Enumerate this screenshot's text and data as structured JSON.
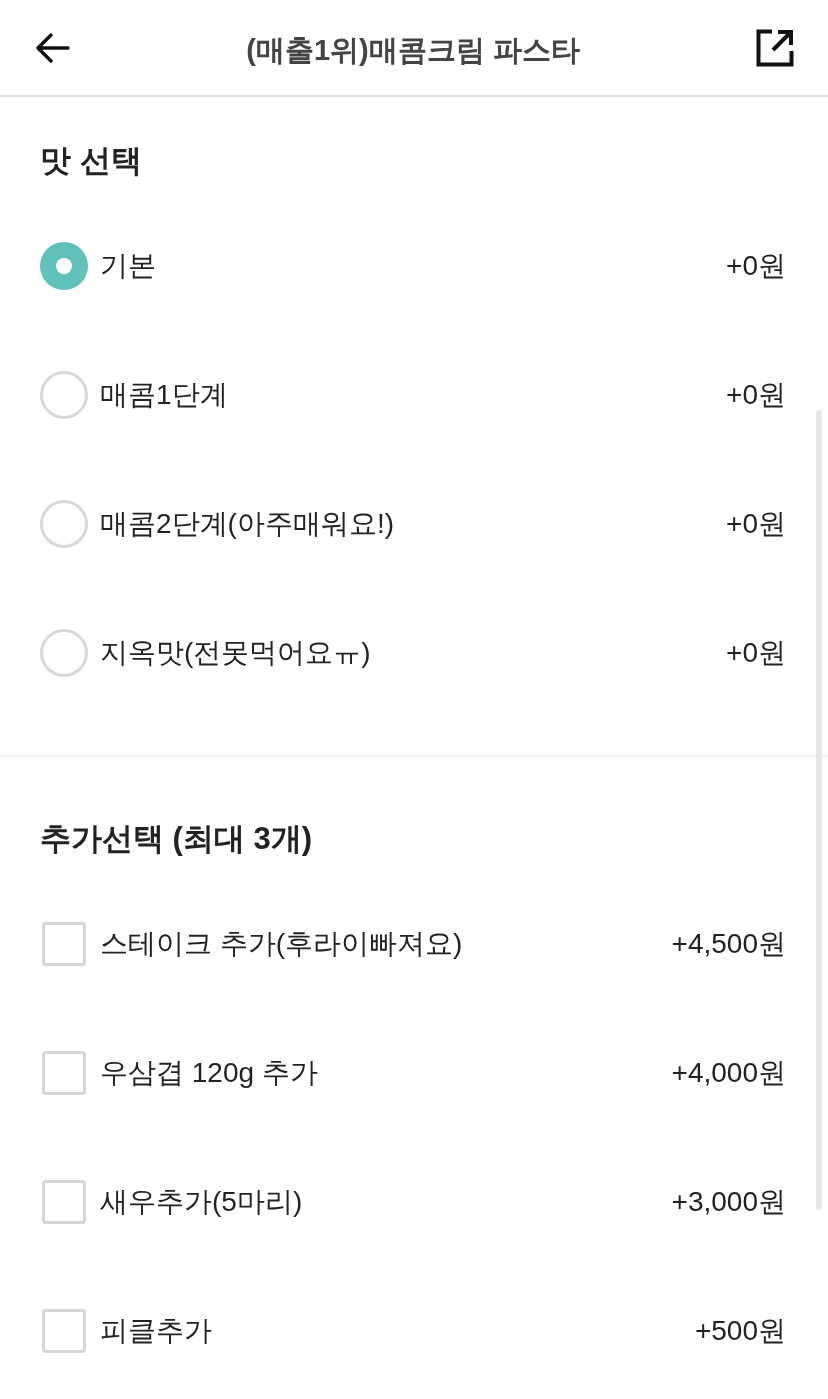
{
  "header": {
    "title": "(매출1위)매콤크림 파스타"
  },
  "sections": [
    {
      "kind": "radio",
      "title": "맛 선택",
      "options": [
        {
          "label": "기본",
          "price": "+0원",
          "selected": true
        },
        {
          "label": "매콤1단계",
          "price": "+0원",
          "selected": false
        },
        {
          "label": "매콤2단계(아주매워요!)",
          "price": "+0원",
          "selected": false
        },
        {
          "label": "지옥맛(전못먹어요ㅠ)",
          "price": "+0원",
          "selected": false
        }
      ]
    },
    {
      "kind": "checkbox",
      "title": "추가선택 (최대 3개)",
      "options": [
        {
          "label": "스테이크 추가(후라이빠져요)",
          "price": "+4,500원",
          "checked": false
        },
        {
          "label": "우삼겹 120g 추가",
          "price": "+4,000원",
          "checked": false
        },
        {
          "label": "새우추가(5마리)",
          "price": "+3,000원",
          "checked": false
        },
        {
          "label": "피클추가",
          "price": "+500원",
          "checked": false
        }
      ]
    }
  ]
}
